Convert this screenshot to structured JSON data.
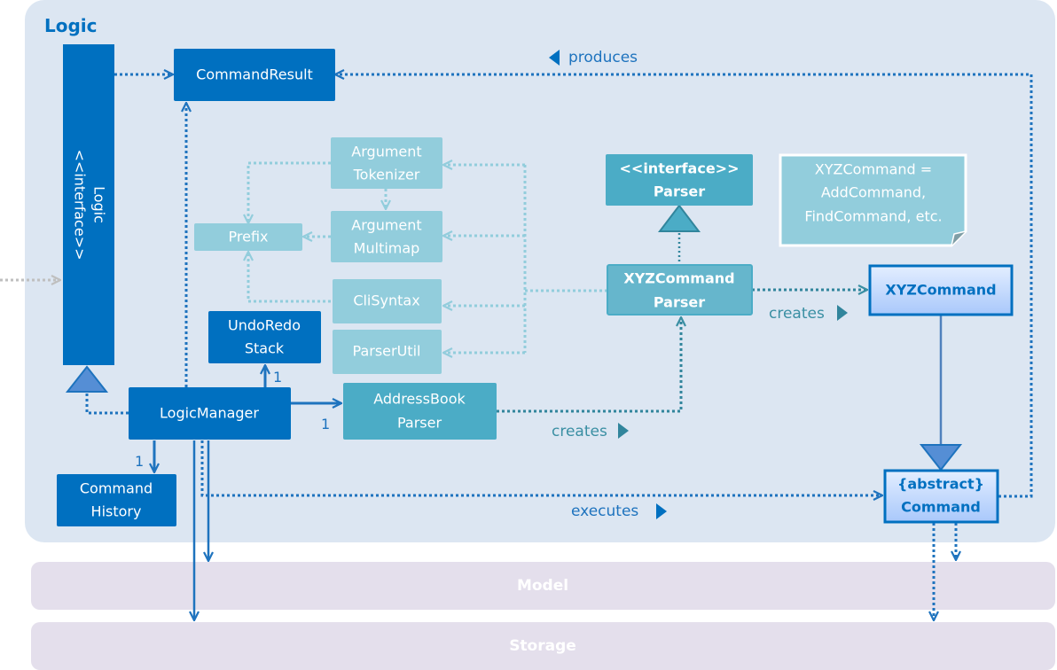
{
  "diagram": {
    "package_title": "Logic",
    "colors": {
      "package_bg": "#dce6f2",
      "dark_blue": "#0070c0",
      "teal": "#4bacc6",
      "teal_light": "#92cddc",
      "teal_mid": "#66b6cc",
      "layer_bg": "#e4dfec",
      "command_fill_top": "#e3eeff",
      "command_fill_bottom": "#a9c8fb"
    },
    "classes": {
      "logic_interface": {
        "stereotype": "<<interface>>",
        "name": "Logic"
      },
      "command_result": {
        "name": "CommandResult"
      },
      "argument_tokenizer": {
        "line1": "Argument",
        "line2": "Tokenizer"
      },
      "argument_multimap": {
        "line1": "Argument",
        "line2": "Multimap"
      },
      "prefix": {
        "name": "Prefix"
      },
      "cli_syntax": {
        "name": "CliSyntax"
      },
      "parser_util": {
        "name": "ParserUtil"
      },
      "undo_redo_stack": {
        "line1": "UndoRedo",
        "line2": "Stack"
      },
      "logic_manager": {
        "name": "LogicManager"
      },
      "command_history": {
        "line1": "Command",
        "line2": "History"
      },
      "address_book_parser": {
        "line1": "AddressBook",
        "line2": "Parser"
      },
      "parser_interface": {
        "stereotype": "<<interface>>",
        "name": "Parser"
      },
      "xyz_command_parser": {
        "line1": "XYZCommand",
        "line2": "Parser"
      },
      "xyz_command": {
        "name": "XYZCommand"
      },
      "abstract_command": {
        "stereotype": "{abstract}",
        "name": "Command"
      }
    },
    "note": {
      "line1": "XYZCommand =",
      "line2": "AddCommand,",
      "line3": "FindCommand, etc."
    },
    "labels": {
      "produces": "produces",
      "creates_parser": "creates",
      "creates_command": "creates",
      "executes": "executes"
    },
    "multiplicities": {
      "undo_redo": "1",
      "address_book_parser": "1",
      "command_history": "1"
    },
    "layers": {
      "model": "Model",
      "storage": "Storage"
    }
  }
}
